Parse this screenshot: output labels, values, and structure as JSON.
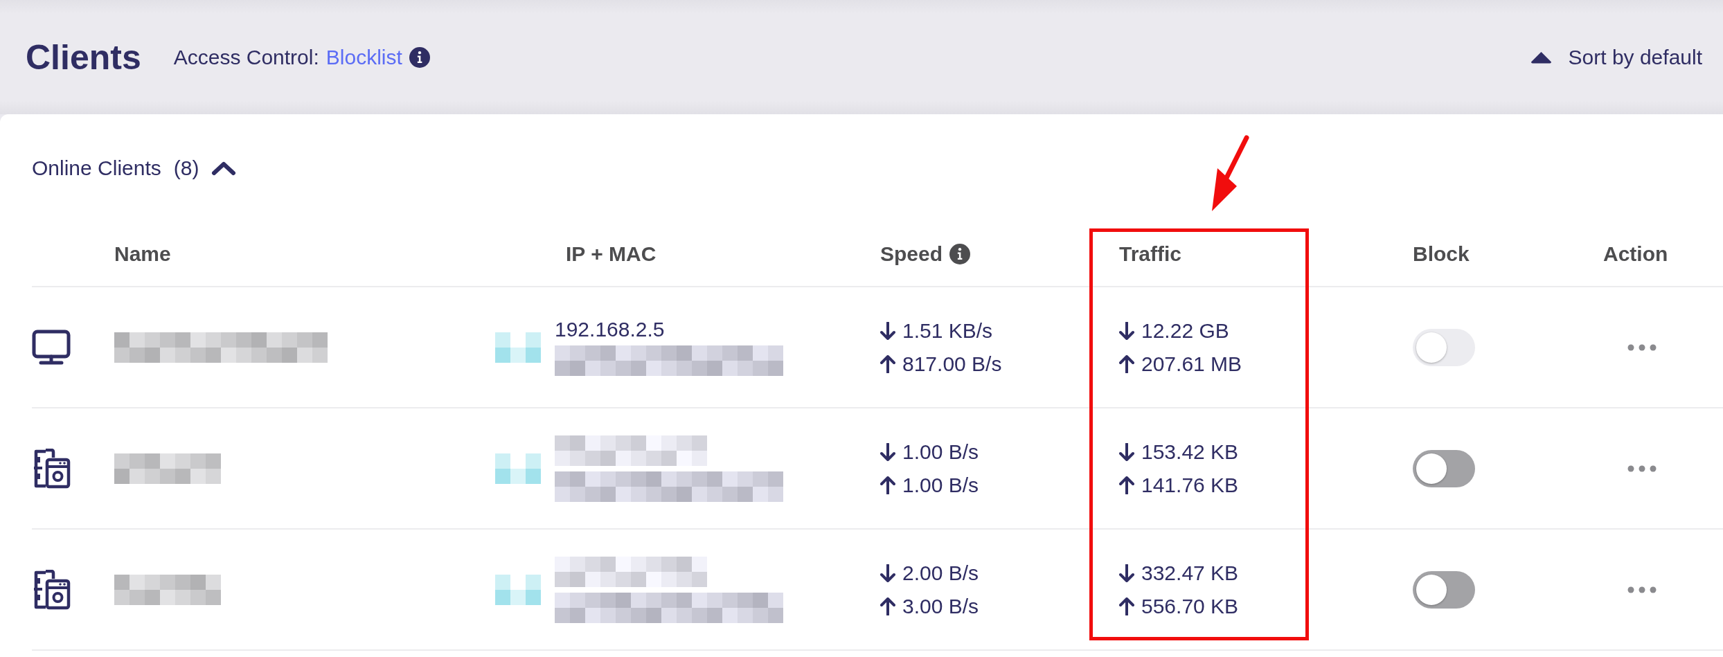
{
  "page": {
    "title": "Clients",
    "access_control_label": "Access Control:",
    "access_control_value": "Blocklist",
    "sort_label": "Sort by default"
  },
  "section": {
    "title": "Online Clients",
    "count": "(8)",
    "expanded": true
  },
  "columns": [
    {
      "label": "Name"
    },
    {
      "label": "IP + MAC"
    },
    {
      "label": "Speed",
      "info": true
    },
    {
      "label": "Traffic",
      "highlighted": true
    },
    {
      "label": "Block"
    },
    {
      "label": "Action"
    }
  ],
  "rows": [
    {
      "kind": "computer",
      "ip": "192.168.2.5",
      "speed_down": "1.51 KB/s",
      "speed_up": "817.00 B/s",
      "traffic_down": "12.22 GB",
      "traffic_up": "207.61 MB",
      "blocked": false,
      "disabled": true
    },
    {
      "kind": "appliance",
      "speed_down": "1.00 B/s",
      "speed_up": "1.00 B/s",
      "traffic_down": "153.42 KB",
      "traffic_up": "141.76 KB",
      "blocked": false,
      "disabled": false
    },
    {
      "kind": "appliance",
      "speed_down": "2.00 B/s",
      "speed_up": "3.00 B/s",
      "traffic_down": "332.47 KB",
      "traffic_up": "556.70 KB",
      "blocked": false,
      "disabled": false
    }
  ]
}
